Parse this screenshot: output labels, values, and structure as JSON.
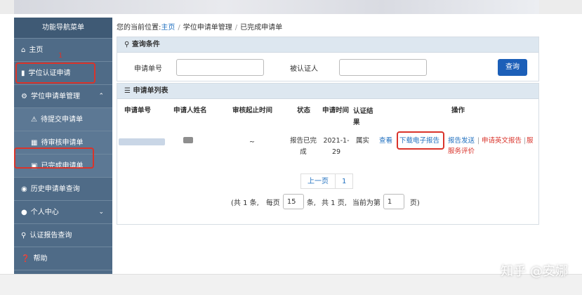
{
  "sidebar": {
    "title": "功能导航菜单",
    "items": [
      {
        "label": "主页",
        "icon": "home-icon"
      },
      {
        "label": "学位认证申请",
        "icon": "document-icon"
      },
      {
        "label": "学位申请单管理",
        "icon": "gear-icon"
      },
      {
        "label": "待提交申请单",
        "icon": "warning-icon"
      },
      {
        "label": "待审核申请单",
        "icon": "cart-icon"
      },
      {
        "label": "已完成申请单",
        "icon": "briefcase-icon"
      },
      {
        "label": "历史申请单查询",
        "icon": "camera-icon"
      },
      {
        "label": "个人中心",
        "icon": "user-icon"
      },
      {
        "label": "认证报告查询",
        "icon": "search-icon"
      },
      {
        "label": "帮助",
        "icon": "help-icon"
      }
    ],
    "annotation_mark": "1"
  },
  "breadcrumb": {
    "prefix": "您的当前位置:",
    "home": "主页",
    "level2": "学位申请单管理",
    "level3": "已完成申请单"
  },
  "query": {
    "title": "查询条件",
    "field1_label": "申请单号",
    "field2_label": "被认证人",
    "button": "查询"
  },
  "list": {
    "title": "申请单列表",
    "headers": [
      "申请单号",
      "申请人姓名",
      "审核起止时间",
      "状态",
      "申请时间",
      "认证结果",
      "操作"
    ],
    "row": {
      "period": "~",
      "status": "报告已完成",
      "date": "2021-1-29",
      "result": "属实",
      "actions": {
        "view": "查看",
        "download": "下载电子报告",
        "send": "报告发送",
        "english": "申请英文报告",
        "evaluate": "服务评价"
      }
    }
  },
  "pagination": {
    "prev": "上一页",
    "page": "1",
    "total_text": "(共 1 条,",
    "per_page_label": "每页",
    "per_page_value": "15",
    "unit_text": "条,",
    "pages_text": "共 1 页,",
    "current_label": "当前为第",
    "current_value": "1",
    "page_suffix": "页)"
  },
  "watermark": "知乎 @安娜",
  "colors": {
    "sidebar": "#4f6b87",
    "accent": "#1c5fb8",
    "highlight": "#d9342b"
  }
}
